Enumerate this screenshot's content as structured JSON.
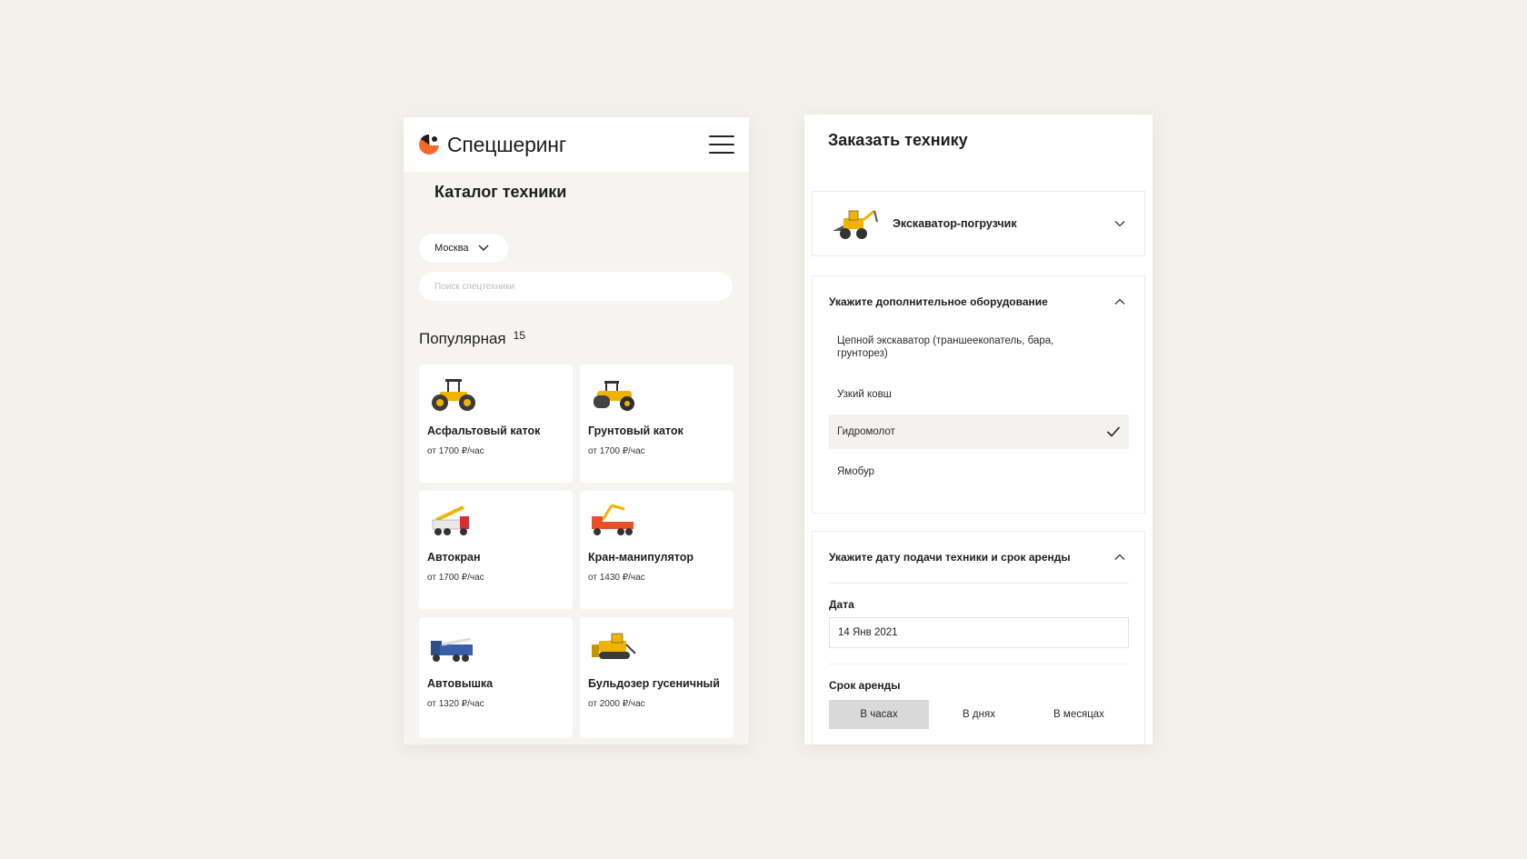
{
  "catalog_screen": {
    "brand": "Спецшеринг",
    "title": "Каталог техники",
    "city": "Москва",
    "search_placeholder": "Поиск спецтехники",
    "popular": {
      "title": "Популярная",
      "count": "15"
    },
    "items": [
      {
        "name": "Асфальтовый каток",
        "price": "от 1700 ₽/час"
      },
      {
        "name": "Грунтовый каток",
        "price": "от 1700 ₽/час"
      },
      {
        "name": "Автокран",
        "price": "от 1700 ₽/час"
      },
      {
        "name": "Кран-манипулятор",
        "price": "от 1430 ₽/час"
      },
      {
        "name": "Автовышка",
        "price": "от 1320 ₽/час"
      },
      {
        "name": "Бульдозер гусеничный",
        "price": "от 2000 ₽/час"
      }
    ]
  },
  "order_screen": {
    "title": "Заказать технику",
    "machine": "Экскаватор-погрузчик",
    "equipment": {
      "title": "Укажите дополнительное оборудование",
      "options": [
        {
          "label": "Цепной экскаватор (траншеекопатель, бара, грунторез)",
          "selected": false
        },
        {
          "label": "Узкий ковш",
          "selected": false
        },
        {
          "label": "Гидромолот",
          "selected": true
        },
        {
          "label": "Ямобур",
          "selected": false
        }
      ]
    },
    "schedule": {
      "title": "Укажите дату подачи техники и срок аренды",
      "date_label": "Дата",
      "date_value": "14 Янв 2021",
      "term_label": "Срок аренды",
      "terms": [
        "В часах",
        "В днях",
        "В месяцах"
      ],
      "active_term": "В часах"
    }
  },
  "colors": {
    "brand_orange": "#f26b2b",
    "background": "#f3efea",
    "machine_yellow": "#f0b400"
  }
}
